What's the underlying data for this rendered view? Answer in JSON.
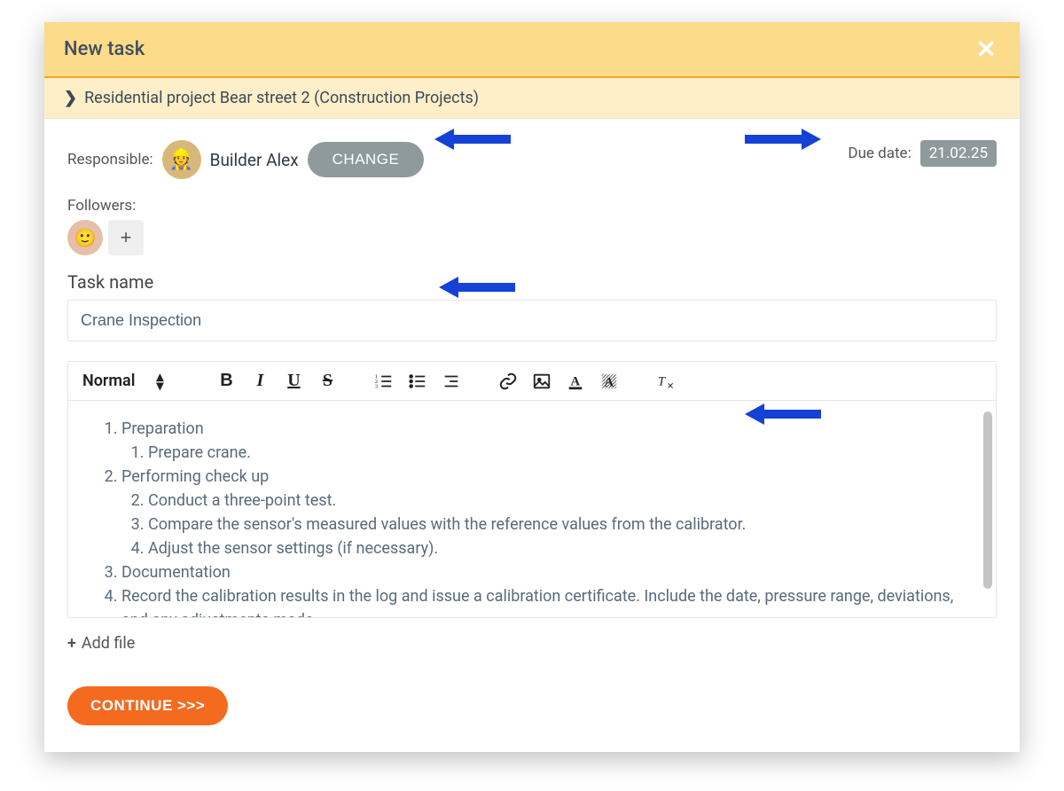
{
  "header": {
    "title": "New task"
  },
  "subheader": {
    "text": "Residential project Bear street 2 (Construction Projects)"
  },
  "responsible": {
    "label": "Responsible:",
    "name": "Builder Alex",
    "change_label": "CHANGE"
  },
  "due": {
    "label": "Due date:",
    "value": "21.02.25"
  },
  "followers": {
    "label": "Followers:"
  },
  "task_name": {
    "label": "Task name",
    "value": "Crane Inspection"
  },
  "toolbar": {
    "format_label": "Normal"
  },
  "content": {
    "item1": "Preparation",
    "item1a": "Prepare crane.",
    "item2": "Performing check up",
    "item2b": "Conduct a three-point test.",
    "item2c": "Compare the sensor's measured values with the reference values from the calibrator.",
    "item2d": "Adjust the sensor settings (if necessary).",
    "item3": " Documentation",
    "item4": "Record the calibration results in the log and issue a calibration certificate. Include the date, pressure range, deviations, and any adjustments made."
  },
  "add_file": {
    "label": "Add file"
  },
  "continue": {
    "label": "CONTINUE >>>"
  }
}
